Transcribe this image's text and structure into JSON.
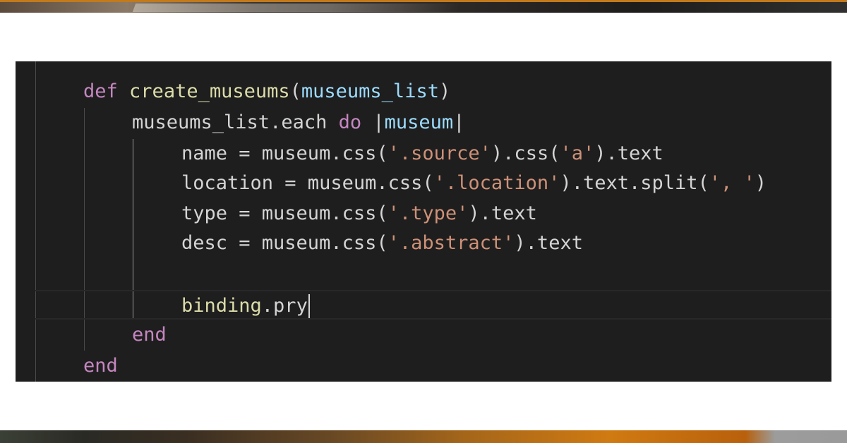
{
  "code": {
    "line1": {
      "kw": "def",
      "fn": "create_museums",
      "open": "(",
      "param": "museums_list",
      "close": ")"
    },
    "line2": {
      "recv": "museums_list.each",
      "kw": "do",
      "pipe_open": "|",
      "param": "museum",
      "pipe_close": "|"
    },
    "line3": {
      "pre": "name = museum.css(",
      "s1": "'.source'",
      "mid": ").css(",
      "s2": "'a'",
      "post": ").text"
    },
    "line4": {
      "pre": "location = museum.css(",
      "s1": "'.location'",
      "mid": ").text.split(",
      "s2": "', '",
      "post": ")"
    },
    "line5": {
      "pre": "type = museum.css(",
      "s1": "'.type'",
      "post": ").text"
    },
    "line6": {
      "pre": "desc = museum.css(",
      "s1": "'.abstract'",
      "post": ").text"
    },
    "line8": {
      "fn": "binding",
      "post": ".pry"
    },
    "line9": {
      "kw": "end"
    },
    "line10": {
      "kw": "end"
    }
  },
  "colors": {
    "keyword": "#c586c0",
    "function": "#dcdcaa",
    "parameter": "#9cdcfe",
    "string": "#ce9178",
    "text": "#d4d4d4",
    "background": "#1e1e1e"
  }
}
